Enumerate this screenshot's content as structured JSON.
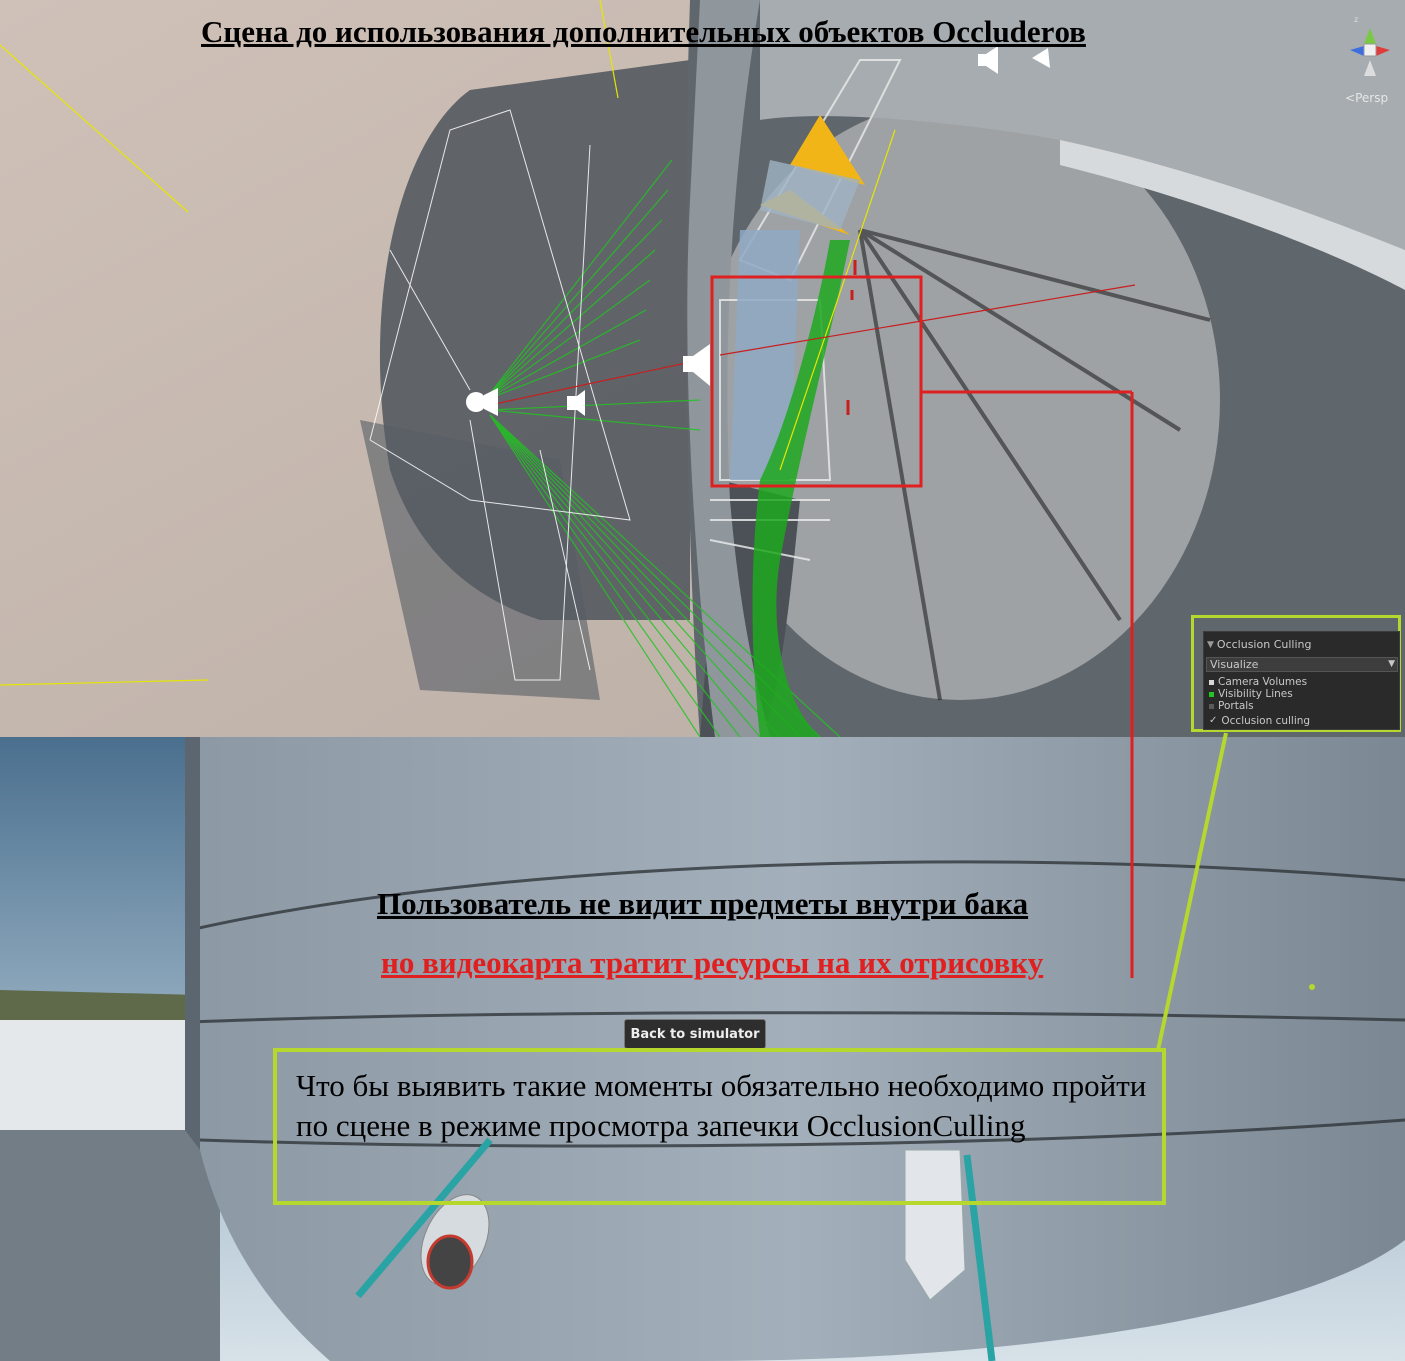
{
  "annotations": {
    "title": "Сцена до использования дополнительных объектов Occluderов",
    "user_cannot_see": "Пользователь не видит предметы внутри бака",
    "gpu_wastes": "но видеокарта тратит ресурсы на их отрисовку",
    "note": "Что бы выявить такие моменты обязательно необходимо пройти по сцене в режиме просмотра запечки OcclusionCulling"
  },
  "scene_view": {
    "projection_label": "Persp",
    "occlusion_panel": {
      "title": "Occlusion Culling",
      "mode": "Visualize",
      "items": [
        {
          "label": "Camera Volumes",
          "color": "#d8d8d8"
        },
        {
          "label": "Visibility Lines",
          "color": "#22c322"
        },
        {
          "label": "Portals",
          "color": "#5a5a5a"
        }
      ],
      "toggle_label": "Occlusion culling",
      "toggle_checked": true
    }
  },
  "game_view": {
    "back_button": "Back to simulator"
  },
  "colors": {
    "highlight_green": "#b5d72e",
    "highlight_red": "#e02020",
    "visibility_lines": "#22c322"
  }
}
